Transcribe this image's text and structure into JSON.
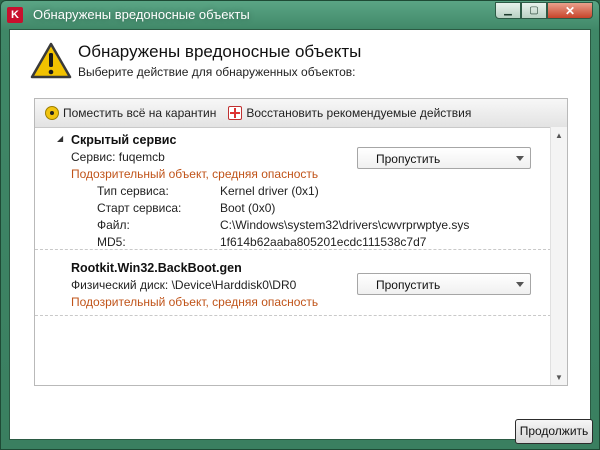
{
  "window": {
    "title": "Обнаружены вредоносные объекты",
    "app_icon_letter": "K",
    "caption": {
      "minimize": "▁",
      "maximize": "▢",
      "close": "✕"
    }
  },
  "header": {
    "title": "Обнаружены вредоносные объекты",
    "subtitle": "Выберите действие для обнаруженных объектов:"
  },
  "toolbar": {
    "quarantine_all": "Поместить всё на карантин",
    "restore_recommended": "Восстановить рекомендуемые действия"
  },
  "threats": [
    {
      "name": "Скрытый сервис",
      "service_line": "Сервис: fuqemcb",
      "verdict": "Подозрительный объект, средняя опасность",
      "action": "Пропустить",
      "details": [
        {
          "label": "Тип сервиса:",
          "value": "Kernel driver (0x1)"
        },
        {
          "label": "Старт сервиса:",
          "value": "Boot (0x0)"
        },
        {
          "label": "Файл:",
          "value": "C:\\Windows\\system32\\drivers\\cwvrprwptye.sys"
        },
        {
          "label": "MD5:",
          "value": "1f614b62aaba805201ecdc111538c7d7"
        }
      ]
    },
    {
      "name": "Rootkit.Win32.BackBoot.gen",
      "service_line": "Физический диск: \\Device\\Harddisk0\\DR0",
      "verdict": "Подозрительный объект, средняя опасность",
      "action": "Пропустить"
    }
  ],
  "footer": {
    "continue": "Продолжить"
  },
  "colors": {
    "frame": "#3f8767",
    "danger_text": "#c0541a",
    "close_button": "#c7442a",
    "warning": "#f2c200"
  },
  "icons": {
    "app": "kaspersky-logo-icon",
    "warning": "warning-triangle-icon",
    "quarantine": "radiation-icon",
    "restore": "red-cross-icon"
  }
}
